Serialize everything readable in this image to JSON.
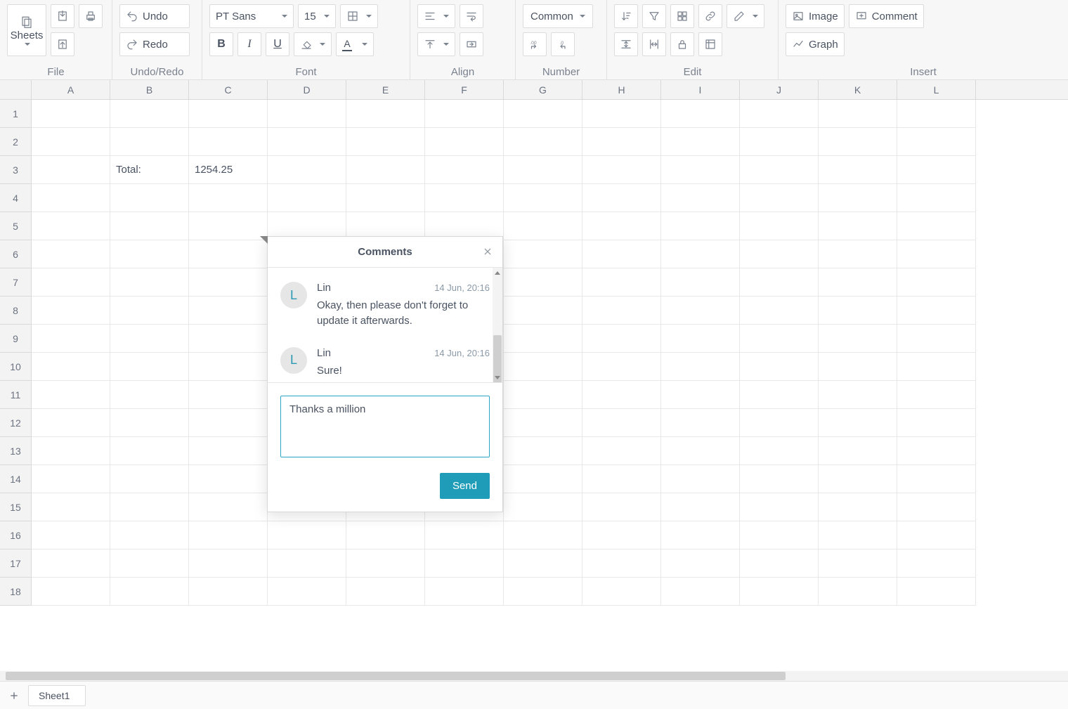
{
  "toolbar": {
    "file": {
      "label": "File",
      "sheets_label": "Sheets"
    },
    "undo_redo": {
      "label": "Undo/Redo",
      "undo_label": "Undo",
      "redo_label": "Redo"
    },
    "font": {
      "label": "Font",
      "name": "PT Sans",
      "size": "15",
      "bold": "B",
      "italic": "I",
      "underline": "U"
    },
    "align": {
      "label": "Align"
    },
    "number": {
      "label": "Number",
      "common_label": "Common"
    },
    "edit": {
      "label": "Edit"
    },
    "insert": {
      "label": "Insert",
      "image_label": "Image",
      "comment_label": "Comment",
      "graph_label": "Graph"
    }
  },
  "grid": {
    "columns": [
      "A",
      "B",
      "C",
      "D",
      "E",
      "F",
      "G",
      "H",
      "I",
      "J",
      "K",
      "L"
    ],
    "rows": 18,
    "cells": {
      "B3": "Total:",
      "C3": "1254.25"
    }
  },
  "tabs": {
    "sheet1": "Sheet1"
  },
  "comments": {
    "title": "Comments",
    "items": [
      {
        "initial": "L",
        "name": "Lin",
        "time": "14 Jun, 20:16",
        "text": "Okay, then please don't forget to update it afterwards."
      },
      {
        "initial": "L",
        "name": "Lin",
        "time": "14 Jun, 20:16",
        "text": "Sure!"
      }
    ],
    "draft": "Thanks a million",
    "send_label": "Send"
  }
}
